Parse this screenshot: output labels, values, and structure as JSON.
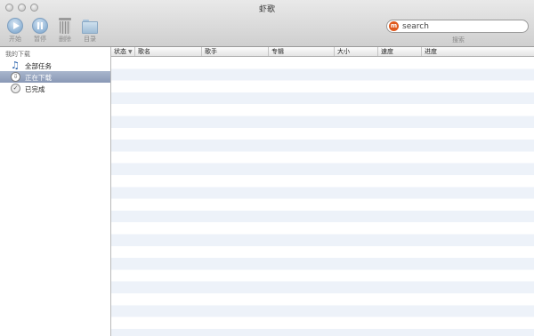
{
  "window": {
    "title": "虾歌"
  },
  "toolbar": {
    "start_label": "开始",
    "pause_label": "暂停",
    "delete_label": "删除",
    "folder_label": "目录"
  },
  "search": {
    "value": "search",
    "label": "搜索"
  },
  "sidebar": {
    "heading": "我的下载",
    "items": [
      {
        "label": "全部任务",
        "icon": "music-note-icon",
        "active": false
      },
      {
        "label": "正在下载",
        "icon": "download-icon",
        "active": true
      },
      {
        "label": "已完成",
        "icon": "checkmark-icon",
        "active": false
      }
    ]
  },
  "table": {
    "columns": [
      "状态",
      "歌名",
      "歌手",
      "专辑",
      "大小",
      "速度",
      "进度"
    ],
    "sort_column": "状态",
    "rows": []
  },
  "colors": {
    "selection": "#8998b5",
    "stripe": "#edf2f9",
    "search_logo": "#e05a1e"
  }
}
